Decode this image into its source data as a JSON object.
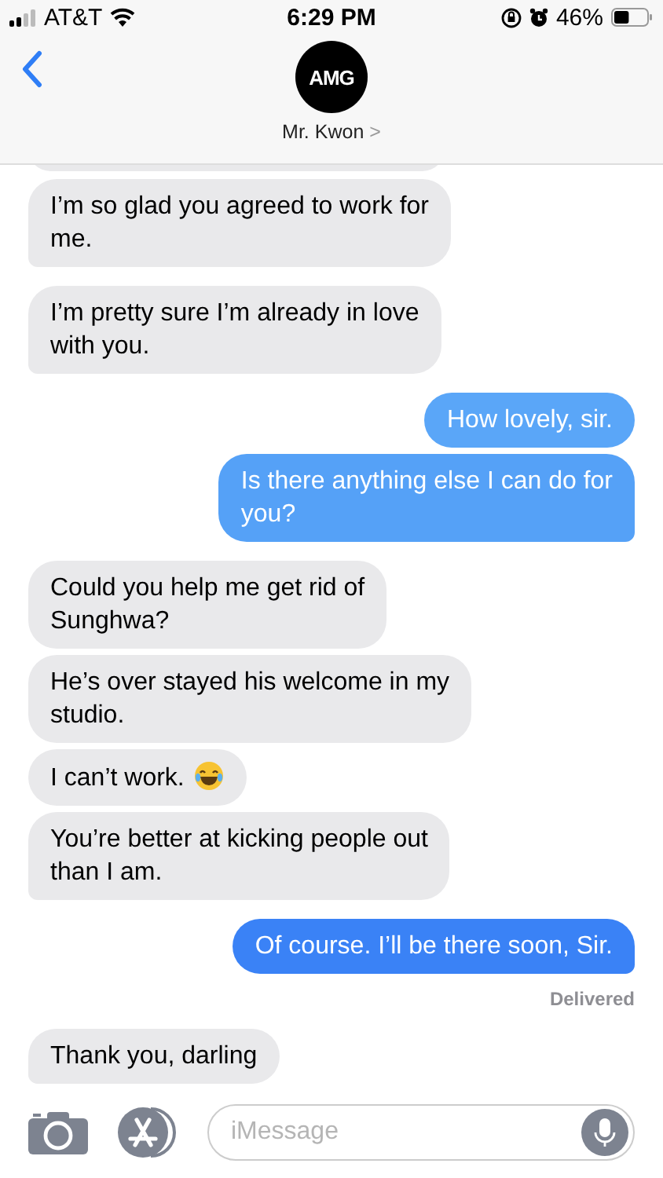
{
  "status_bar": {
    "carrier": "AT&T",
    "time": "6:29 PM",
    "battery": "46%"
  },
  "header": {
    "avatar_text": "AMG",
    "contact": "Mr. Kwon",
    "chevron": ">"
  },
  "messages": [
    {
      "outgoing": false,
      "text": "I’m so glad you agreed to work for\nme.",
      "tail": true,
      "color": "#e9e9eb"
    },
    {
      "outgoing": false,
      "text": "I’m pretty sure I’m already in love\nwith you.",
      "tail": true,
      "color": "#e9e9eb"
    },
    {
      "outgoing": true,
      "text": "How lovely, sir.",
      "tail": false,
      "color": "#5aa6f8"
    },
    {
      "outgoing": true,
      "text": "Is there anything else I can do for\nyou?",
      "tail": true,
      "color": "#55a1f7"
    },
    {
      "outgoing": false,
      "text": "Could you help me get rid of\nSunghwa?",
      "tail": false,
      "color": "#e9e9eb"
    },
    {
      "outgoing": false,
      "text": "He’s over stayed his welcome in my\nstudio.",
      "tail": false,
      "color": "#e9e9eb"
    },
    {
      "outgoing": false,
      "text": "I can’t work.",
      "has_emoji": true,
      "tail": false,
      "color": "#e9e9eb"
    },
    {
      "outgoing": false,
      "text": "You’re better at kicking people out\nthan I am.",
      "tail": true,
      "color": "#e9e9eb"
    },
    {
      "outgoing": true,
      "text": "Of course. I’ll be there soon, Sir.",
      "tail": true,
      "color": "#3a82f6",
      "receipt": "Delivered"
    },
    {
      "outgoing": false,
      "text": "Thank you, darling",
      "tail": true,
      "color": "#e9e9eb"
    }
  ],
  "composer": {
    "placeholder": "iMessage"
  }
}
